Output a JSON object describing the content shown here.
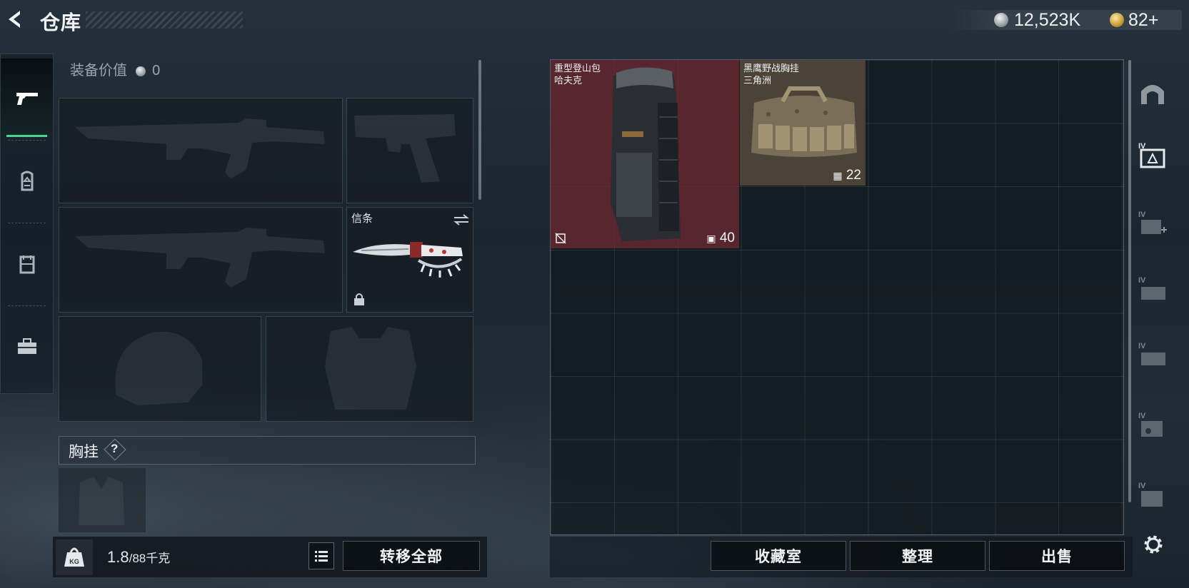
{
  "header": {
    "title": "仓库",
    "silver_amount": "12,523K",
    "gold_amount": "82",
    "gold_add": "+"
  },
  "icons": {
    "back": "back-arrow-icon",
    "silver": "silver-coin-icon",
    "gold": "gold-coin-icon",
    "nav": [
      "pistol-icon",
      "backpack-icon",
      "rig-icon",
      "toolbox-icon"
    ],
    "side": [
      "bunker-icon",
      "container-icon",
      "container-icon",
      "container-icon",
      "container-icon",
      "container-icon",
      "container-icon"
    ],
    "settings": "gear-icon"
  },
  "equipment": {
    "value_label": "装备价值",
    "value_amount": "0",
    "knife_label": "信条",
    "chest_rig_label": "胸挂",
    "help_label": "?"
  },
  "footer_left": {
    "weight_current": "1.8",
    "weight_limit": "/88千克",
    "weight_icon_text": "KG",
    "transfer_all": "转移全部"
  },
  "storage": {
    "items": [
      {
        "line1": "重型登山包",
        "line2": "哈夫克",
        "count": "40",
        "color": "#6e2a33"
      },
      {
        "line1": "黑鹰野战胸挂",
        "line2": "三角洲",
        "count": "22",
        "color": "#4c4338"
      }
    ]
  },
  "footer_right": {
    "collection": "收藏室",
    "organize": "整理",
    "sell": "出售"
  },
  "side_labels": [
    "IV",
    "IV",
    "IV",
    "IV",
    "IV",
    "IV"
  ]
}
